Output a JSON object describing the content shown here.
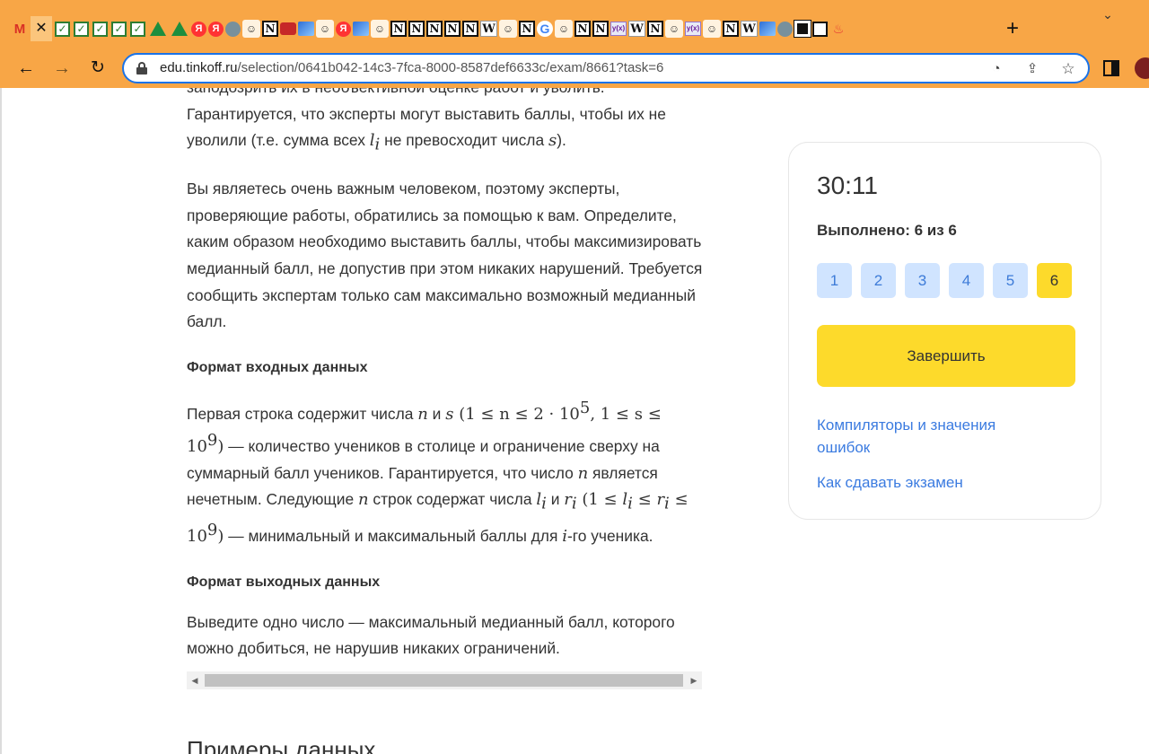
{
  "browser": {
    "url_host": "edu.tinkoff.ru",
    "url_path": "/selection/0641b042-14c3-7fca-8000-8587def6633c/exam/8661?task=6",
    "tab_icons": [
      "gmail-icon",
      "close-tab",
      "check",
      "check",
      "check",
      "check",
      "check",
      "drive",
      "drive",
      "yandex",
      "yandex",
      "globe",
      "avatar",
      "notion",
      "red",
      "img",
      "avatar",
      "yandex",
      "img",
      "avatar",
      "notion",
      "notion",
      "notion",
      "notion",
      "notion",
      "wiki",
      "avatar",
      "notion",
      "google",
      "avatar",
      "notion",
      "notion",
      "desmos",
      "wiki",
      "notion",
      "avatar",
      "desmos",
      "avatar",
      "notion",
      "wiki",
      "img",
      "globe",
      "black",
      "square",
      "flame"
    ],
    "new_tab_label": "+",
    "tab_menu_label": "⌄"
  },
  "problem": {
    "clipped_line": "заподозрить их в необъективной оценке работ и уволить.",
    "para1_a": "Гарантируется, что эксперты могут выставить баллы, чтобы их не уволили (т.е. сумма всех ",
    "para1_var_l": "l",
    "para1_sub_i": "i",
    "para1_b": " не превосходит числа ",
    "para1_var_s": "s",
    "para1_c": ").",
    "para2": "Вы являетесь очень важным человеком, поэтому эксперты, проверяющие работы, обратились за помощью к вам. Определите, каким образом необходимо выставить баллы, чтобы максимизировать медианный балл, не допустив при этом никаких нарушений. Требуется сообщить экспертам только сам максимально возможный медианный балл.",
    "input_heading": "Формат входных данных",
    "input_a": "Первая строка содержит числа ",
    "input_n": "n",
    "input_and": " и ",
    "input_s": "s",
    "input_range1": " (1 ≤ n ≤ 2 · 10",
    "input_exp5": "5",
    "input_range2": ", 1 ≤ s ≤ 10",
    "input_exp9": "9",
    "input_range3": ")",
    "input_b": " — количество учеников в столице и ограничение сверху на суммарный балл учеников. Гарантируется, что число ",
    "input_c": " является нечетным. Следующие ",
    "input_d": " строк содержат числа ",
    "input_l": "l",
    "input_sub_i": "i",
    "input_r": "r",
    "input_range4": " (1 ≤ ",
    "input_range5": " ≤ ",
    "input_range6": " ≤ 10",
    "input_range7": ")",
    "input_e": " — минимальный и максимальный баллы для ",
    "input_i": "i",
    "input_f": "-го ученика.",
    "output_heading": "Формат выходных данных",
    "output_text": "Выведите одно число — максимальный медианный балл, которого можно добиться, не нарушив никаких ограничений.",
    "examples_title": "Примеры данных"
  },
  "sidebar": {
    "timer": "30:11",
    "progress": "Выполнено: 6 из 6",
    "tasks": [
      "1",
      "2",
      "3",
      "4",
      "5",
      "6"
    ],
    "active_task": "6",
    "finish_label": "Завершить",
    "link_compilers": "Компиляторы и значения ошибок",
    "link_howto": "Как сдавать экзамен"
  },
  "colors": {
    "chrome": "#f8a646",
    "accent_yellow": "#fdda2b",
    "task_btn": "#d0e4ff",
    "link": "#3b7be0"
  }
}
